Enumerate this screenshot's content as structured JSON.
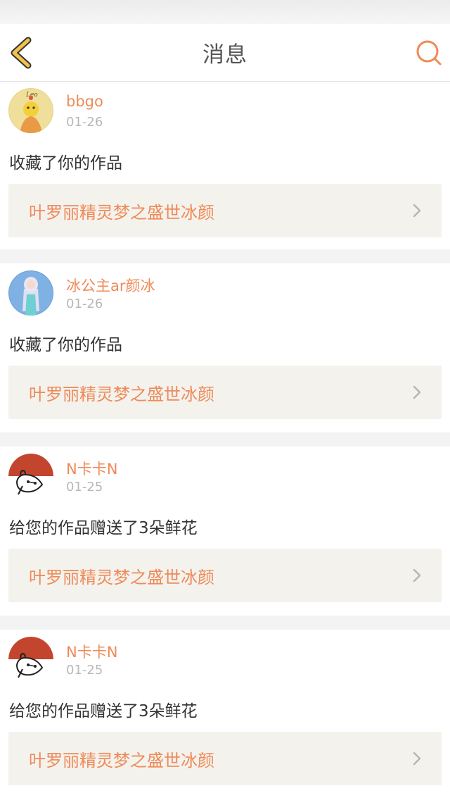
{
  "header": {
    "title": "消息"
  },
  "colors": {
    "accent": "#ef8a58",
    "back_icon": "#f2c24b",
    "card_link_bg": "#f4f2ed"
  },
  "notifications": [
    {
      "user": "bbgo",
      "date": "01-26",
      "action": "收藏了你的作品",
      "work": "叶罗丽精灵梦之盛世冰颜",
      "avatar": "leo-avatar"
    },
    {
      "user": "冰公主ar颜冰",
      "date": "01-26",
      "action": "收藏了你的作品",
      "work": "叶罗丽精灵梦之盛世冰颜",
      "avatar": "doll-avatar"
    },
    {
      "user": "N卡卡N",
      "date": "01-25",
      "action": "给您的作品赠送了3朵鲜花",
      "work": "叶罗丽精灵梦之盛世冰颜",
      "avatar": "baymax-avatar"
    },
    {
      "user": "N卡卡N",
      "date": "01-25",
      "action": "给您的作品赠送了3朵鲜花",
      "work": "叶罗丽精灵梦之盛世冰颜",
      "avatar": "baymax-avatar"
    }
  ]
}
